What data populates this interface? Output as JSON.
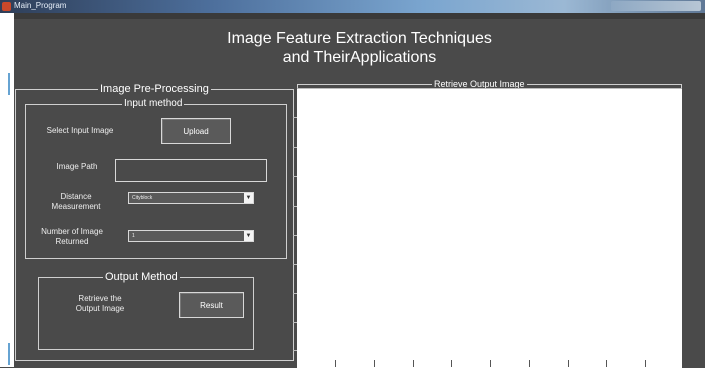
{
  "window": {
    "title": "Main_Program"
  },
  "app": {
    "title_line1": "Image Feature Extraction Techniques",
    "title_line2": "and TheirApplications"
  },
  "preprocessing": {
    "title": "Image Pre-Processing"
  },
  "input_method": {
    "title": "Input method",
    "select_label": "Select Input Image",
    "upload_button": "Upload",
    "path_label": "Image Path",
    "path_value": "",
    "distance_label_line1": "Distance",
    "distance_label_line2": "Measurement",
    "distance_value": "Cityblock",
    "number_label_line1": "Number of Image",
    "number_label_line2": "Returned",
    "number_value": "1"
  },
  "output_method": {
    "title": "Output Method",
    "retrieve_label_line1": "Retrieve the",
    "retrieve_label_line2": "Output Image",
    "result_button": "Result"
  },
  "output_panel": {
    "title": "Retrieve Output Image"
  },
  "icons": {
    "dropdown": "chevron-down-icon",
    "app": "app-icon"
  }
}
